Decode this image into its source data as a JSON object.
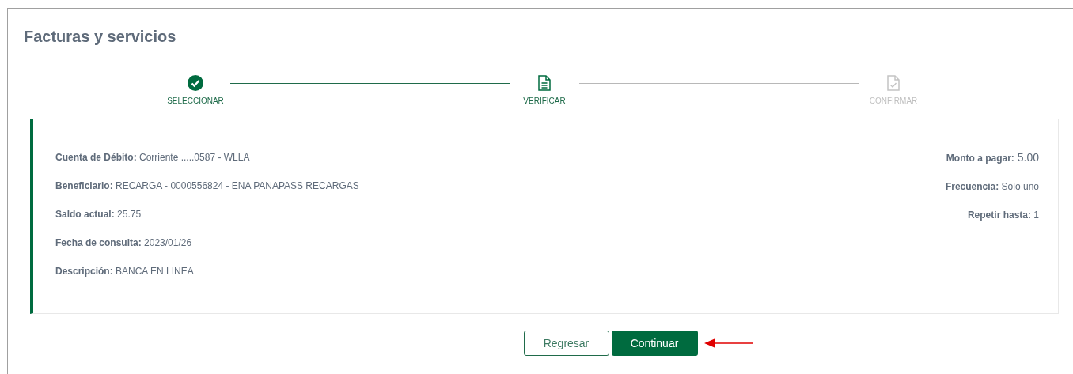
{
  "title": "Facturas y servicios",
  "steps": [
    {
      "label": "SELECCIONAR",
      "kind": "done"
    },
    {
      "label": "VERIFICAR",
      "kind": "current"
    },
    {
      "label": "CONFIRMAR",
      "kind": "pending"
    }
  ],
  "details_left": [
    {
      "label": "Cuenta de Débito:",
      "value": "Corriente .....0587 - WLLA"
    },
    {
      "label": "Beneficiario:",
      "value": "RECARGA - 0000556824 - ENA PANAPASS RECARGAS"
    },
    {
      "label": "Saldo actual:",
      "value": "25.75"
    },
    {
      "label": "Fecha de consulta:",
      "value": "2023/01/26"
    },
    {
      "label": "Descripción:",
      "value": "BANCA EN LINEA"
    }
  ],
  "details_right": [
    {
      "label": "Monto a pagar:",
      "value": "5.00",
      "large": true
    },
    {
      "label": "Frecuencia:",
      "value": "Sólo uno",
      "large": false
    },
    {
      "label": "Repetir hasta:",
      "value": "1",
      "large": false
    }
  ],
  "buttons": [
    {
      "label": "Regresar",
      "kind": "secondary"
    },
    {
      "label": "Continuar",
      "kind": "primary"
    }
  ]
}
